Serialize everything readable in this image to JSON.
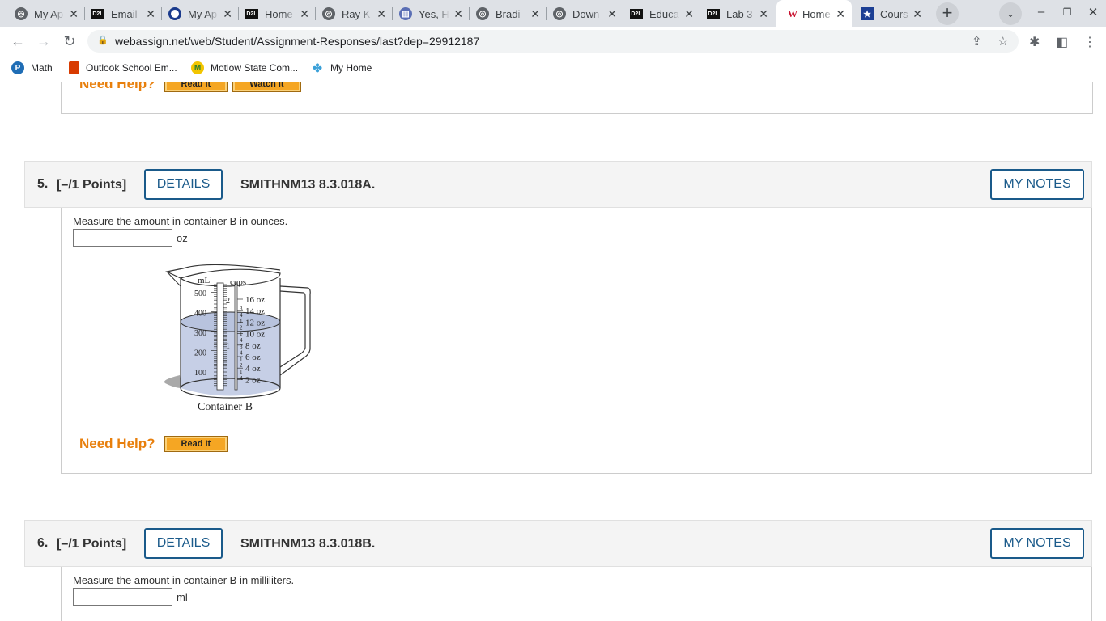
{
  "browser": {
    "tabs": [
      {
        "title": "My Ap",
        "icon": "globe-icon"
      },
      {
        "title": "Email",
        "icon": "d2l-icon"
      },
      {
        "title": "My Ap",
        "icon": "ring-icon"
      },
      {
        "title": "Home",
        "icon": "d2l-icon"
      },
      {
        "title": "Ray K",
        "icon": "globe-icon"
      },
      {
        "title": "Yes, H",
        "icon": "chart-icon"
      },
      {
        "title": "Bradi",
        "icon": "globe-icon"
      },
      {
        "title": "Down",
        "icon": "globe-icon"
      },
      {
        "title": "Educa",
        "icon": "d2l-icon"
      },
      {
        "title": "Lab 3",
        "icon": "d2l-icon"
      },
      {
        "title": "Home",
        "icon": "webassign-icon",
        "active": true
      },
      {
        "title": "Cours",
        "icon": "star-shield-icon"
      }
    ],
    "d2l_label": "D2L",
    "url": "webassign.net/web/Student/Assignment-Responses/last?dep=29912187",
    "bookmarks": [
      {
        "label": "Math",
        "icon": "pearson-icon",
        "color": "#1f6db5"
      },
      {
        "label": "Outlook School Em...",
        "icon": "office-icon",
        "color": "#d83b01"
      },
      {
        "label": "Motlow State Com...",
        "icon": "motlow-icon",
        "color": "#2a7d2e"
      },
      {
        "label": "My Home",
        "icon": "pinwheel-icon",
        "color": "#3aa0d8"
      }
    ]
  },
  "prev": {
    "need_help": "Need Help?",
    "read_it": "Read It",
    "watch_it": "Watch It"
  },
  "q5": {
    "number": "5.",
    "points": "[–/1 Points]",
    "details": "DETAILS",
    "code": "SMITHNM13 8.3.018A.",
    "my_notes": "MY NOTES",
    "prompt": "Measure the amount in container B in ounces.",
    "unit": "oz",
    "answer": "",
    "figure": {
      "caption": "Container B",
      "ml_label": "mL",
      "cups_label": "cups",
      "ml_ticks": [
        "500",
        "400",
        "300",
        "200",
        "100"
      ],
      "cups_ticks": [
        "2",
        "1"
      ],
      "cup_fracs": [
        "3",
        "4",
        "1",
        "2",
        "1",
        "4",
        "3",
        "4",
        "1",
        "2",
        "1",
        "4"
      ],
      "oz_ticks": [
        "16 oz",
        "14 oz",
        "12 oz",
        "10 oz",
        "8 oz",
        "6 oz",
        "4 oz",
        "2 oz"
      ]
    },
    "need_help": "Need Help?",
    "read_it": "Read It"
  },
  "q6": {
    "number": "6.",
    "points": "[–/1 Points]",
    "details": "DETAILS",
    "code": "SMITHNM13 8.3.018B.",
    "my_notes": "MY NOTES",
    "prompt": "Measure the amount in container B in milliliters.",
    "unit": "ml",
    "answer": ""
  },
  "colors": {
    "accent": "#1a5a8a",
    "help_orange": "#e87f0c",
    "button_yellow": "#f5a623",
    "liquid": "#c6cfe6"
  }
}
